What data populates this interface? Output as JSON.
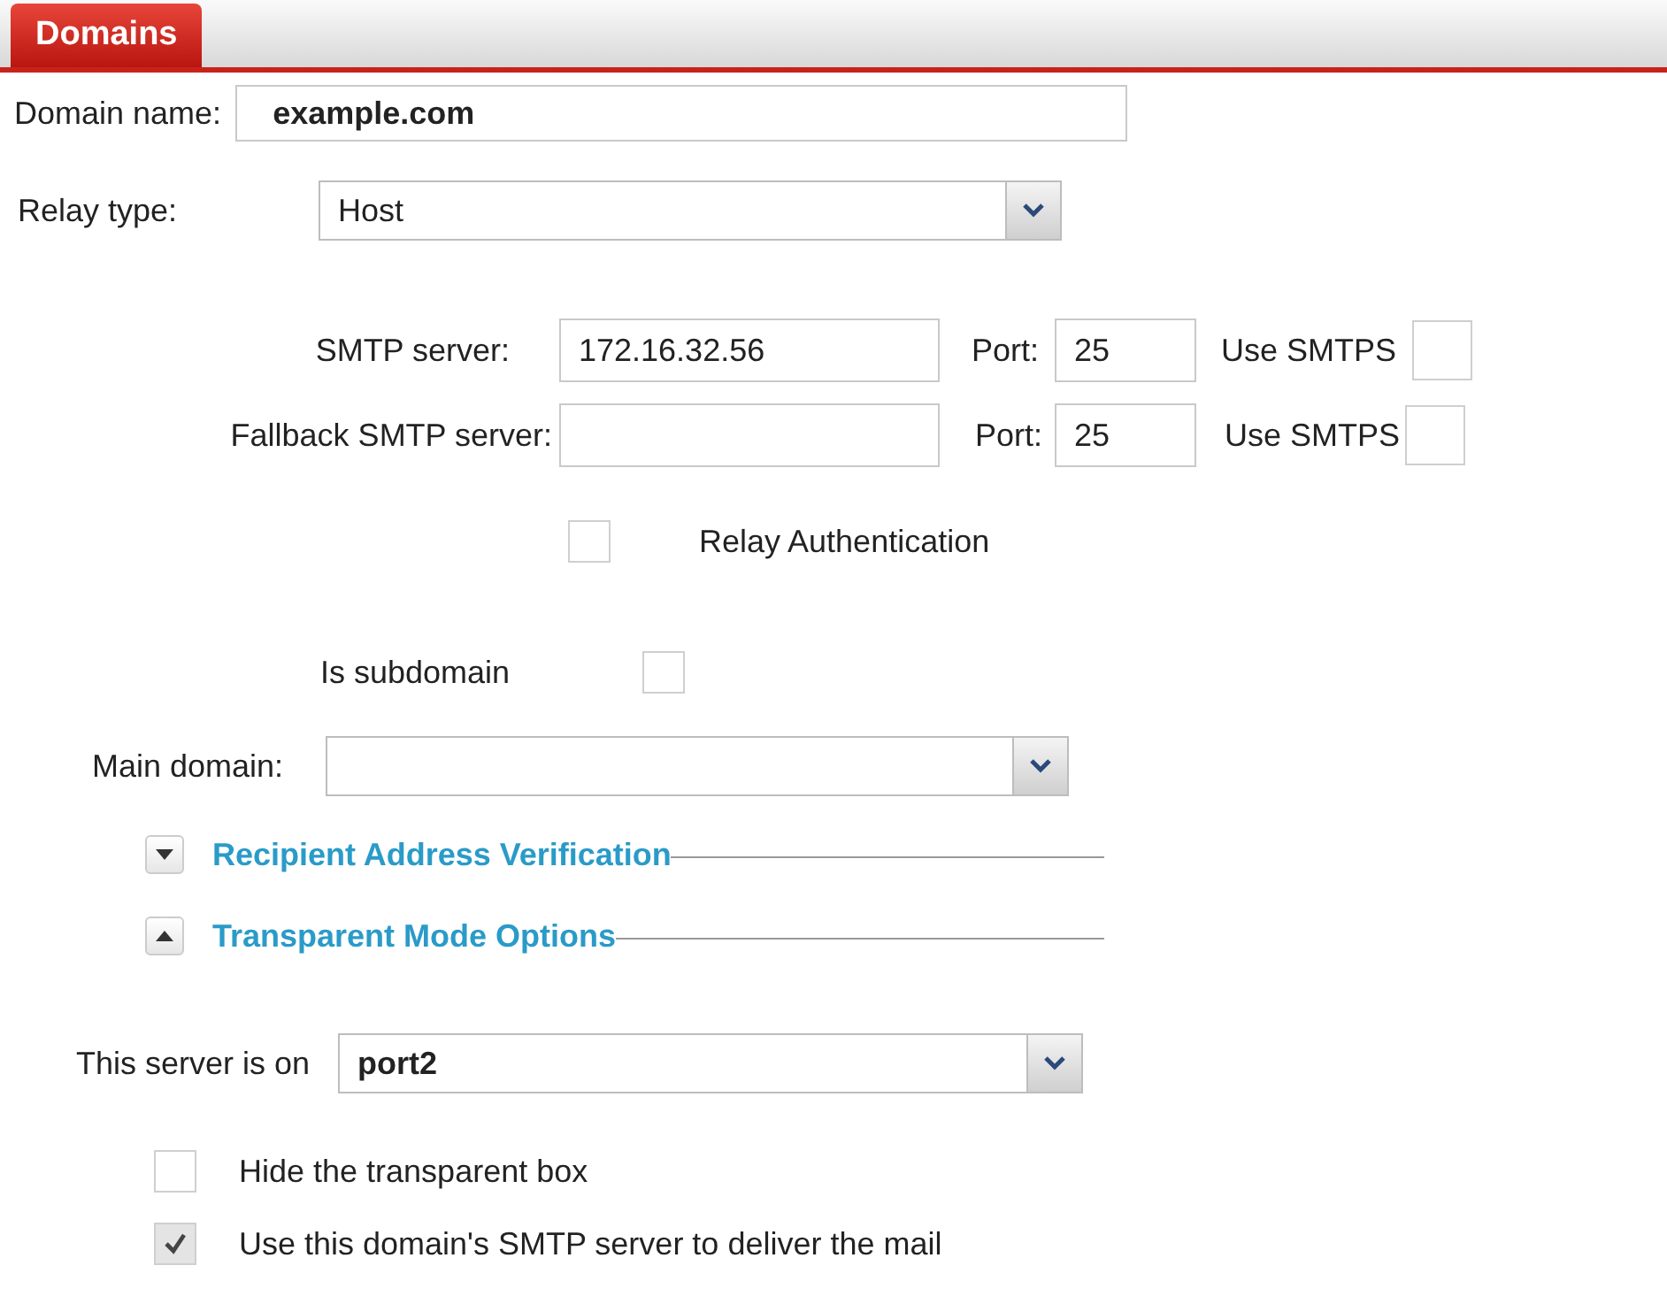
{
  "tab": {
    "label": "Domains",
    "selected": true
  },
  "domain_name": {
    "label": "Domain name:",
    "value": "example.com"
  },
  "relay_type": {
    "label": "Relay type:",
    "value": "Host"
  },
  "servers": [
    {
      "label": "SMTP server:",
      "value": "172.16.32.56",
      "port_label": "Port:",
      "port": "25",
      "smtps_label": "Use SMTPS",
      "use_smtps": false
    },
    {
      "label": "Fallback SMTP server:",
      "port_label": "Port:",
      "port": "25",
      "smtps_label": "Use SMTPS",
      "use_smtps": false
    }
  ],
  "relay_authentication": {
    "label": "Relay Authentication",
    "checked": false
  },
  "is_subdomain": {
    "label": "Is subdomain",
    "checked": false
  },
  "main_domain": {
    "label": "Main domain:"
  },
  "sections": [
    {
      "title": "Recipient Address Verification",
      "expanded": false
    },
    {
      "title": "Transparent Mode Options",
      "expanded": true
    }
  ],
  "server_port": {
    "label": "This server is on",
    "value": "port2"
  },
  "options": [
    {
      "label": "Hide the transparent box",
      "checked": false
    },
    {
      "label": "Use this domain's SMTP server to deliver the mail",
      "checked": true
    }
  ]
}
